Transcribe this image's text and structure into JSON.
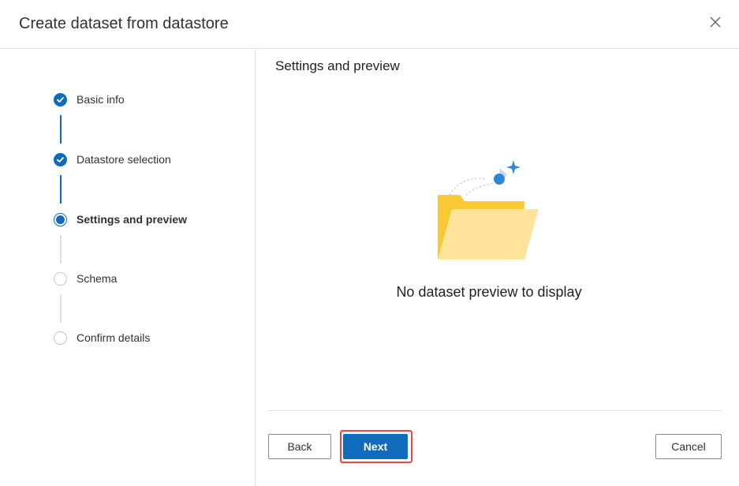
{
  "dialog": {
    "title": "Create dataset from datastore",
    "close_icon": "close-icon"
  },
  "steps": [
    {
      "label": "Basic info",
      "state": "completed"
    },
    {
      "label": "Datastore selection",
      "state": "completed"
    },
    {
      "label": "Settings and preview",
      "state": "current"
    },
    {
      "label": "Schema",
      "state": "pending"
    },
    {
      "label": "Confirm details",
      "state": "pending"
    }
  ],
  "main": {
    "section_title": "Settings and preview",
    "illustration_icon": "empty-folder-icon",
    "empty_message": "No dataset preview to display"
  },
  "footer": {
    "back_label": "Back",
    "next_label": "Next",
    "cancel_label": "Cancel"
  },
  "colors": {
    "accent": "#0f6cbd",
    "highlight_border": "#e04b4b",
    "folder_back": "#f8c934",
    "folder_front": "#fde49a"
  }
}
